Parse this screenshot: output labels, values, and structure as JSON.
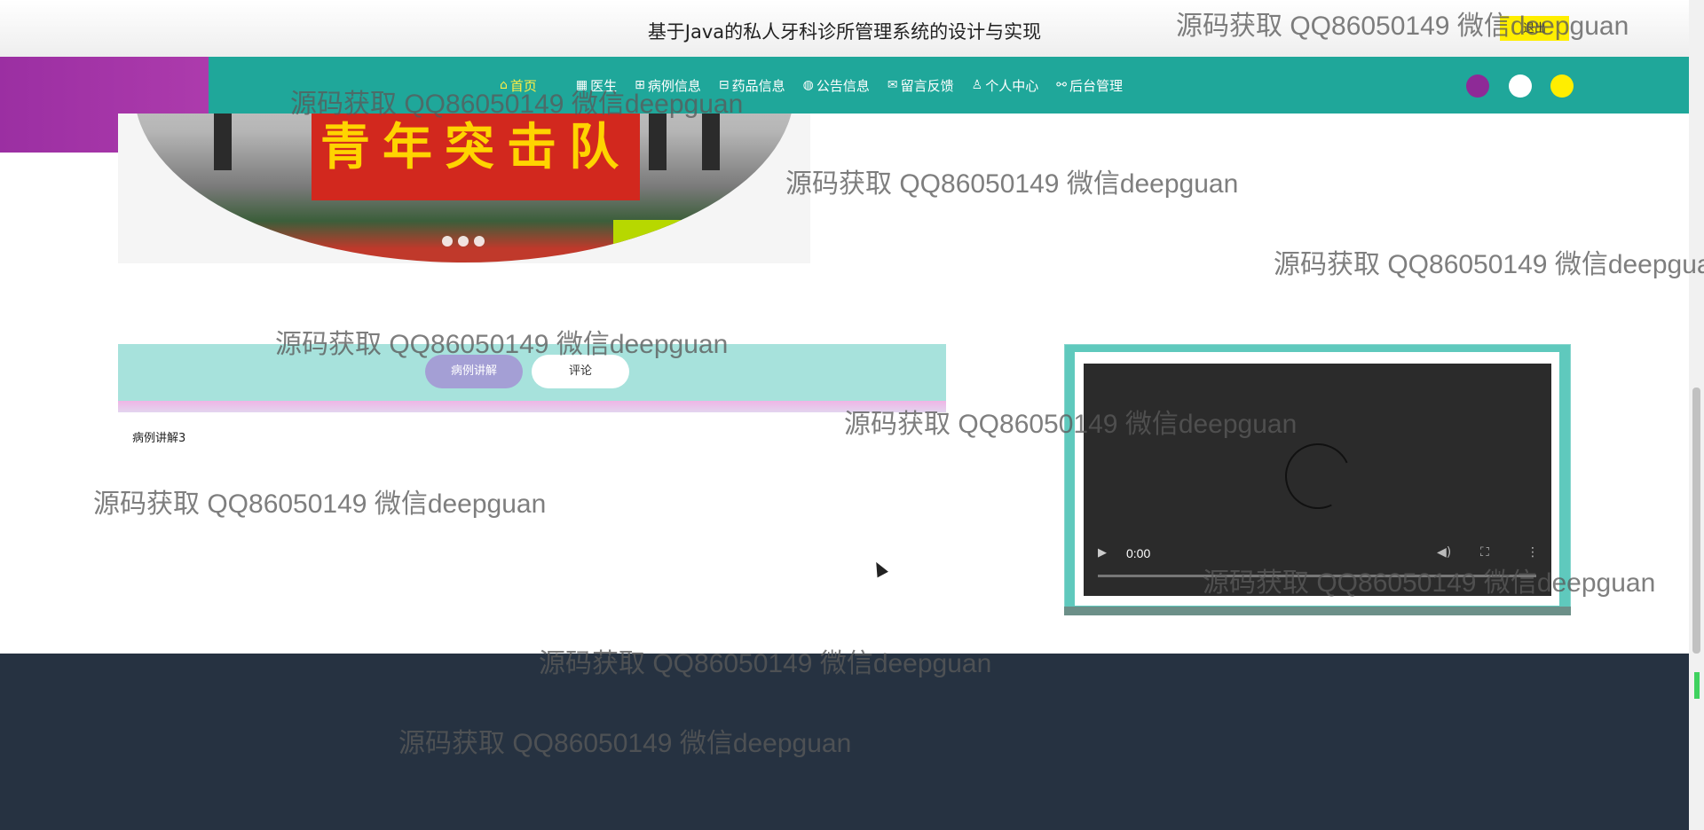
{
  "header": {
    "site_title": "基于Java的私人牙科诊所管理系统的设计与实现",
    "logout_label": "退出"
  },
  "nav": {
    "items": [
      {
        "icon": "home-icon",
        "glyph": "⌂",
        "label": "首页",
        "active": true
      },
      {
        "icon": "doctor-icon",
        "glyph": "▦",
        "label": "医生"
      },
      {
        "icon": "book-icon",
        "glyph": "⊞",
        "label": "病例信息"
      },
      {
        "icon": "gift-icon",
        "glyph": "⊟",
        "label": "药品信息"
      },
      {
        "icon": "globe-icon",
        "glyph": "◍",
        "label": "公告信息"
      },
      {
        "icon": "mail-icon",
        "glyph": "✉",
        "label": "留言反馈"
      },
      {
        "icon": "user-icon",
        "glyph": "♙",
        "label": "个人中心"
      },
      {
        "icon": "link-icon",
        "glyph": "⚯",
        "label": "后台管理"
      }
    ],
    "theme_colors": [
      "#8e2a97",
      "#ffffff",
      "#ffee00"
    ]
  },
  "carousel": {
    "banner_text": "青年突击队",
    "dot_count": 3
  },
  "tabs": {
    "case_label": "病例讲解",
    "comment_label": "评论",
    "content_text": "病例讲解3"
  },
  "video": {
    "time": "0:00"
  },
  "colors": {
    "accent": "#1fa79a",
    "footer": "#263241",
    "tab_strip": "#a7e2dc"
  },
  "watermark": "源码获取 QQ86050149 微信deepguan"
}
